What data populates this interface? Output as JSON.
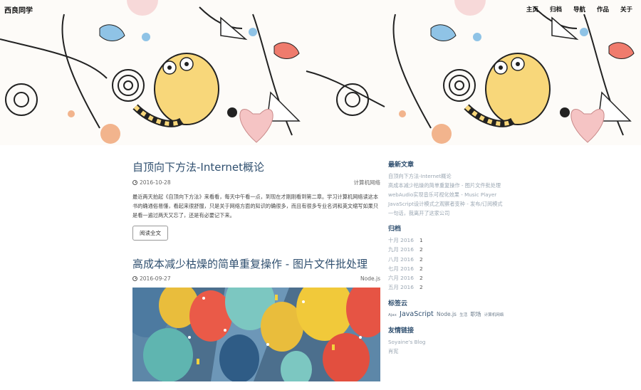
{
  "site": {
    "brand": "西良同学",
    "nav": [
      "主页",
      "归档",
      "导航",
      "作品",
      "关于"
    ]
  },
  "posts": [
    {
      "title": "自顶向下方法-Internet概论",
      "date": "2016-10-28",
      "category": "计算机网络",
      "excerpt": "最近两天拍起《自顶向下方法》来看看，每天中午看一点，到现在才刚刚看到第二章。学习计算机网络读这本书的确通俗易懂，看起来很舒服，只是关于网络方面的知识的确很多，而且有很多专业名词和英文缩写如果只是看一遍过两天又忘了，还是有必要记下来。",
      "button": "阅读全文"
    },
    {
      "title": "高成本减少枯燥的简单重复操作 - 图片文件批处理",
      "date": "2016-09-27",
      "category": "Node.js"
    }
  ],
  "sidebar": {
    "recent_title": "最新文章",
    "recent": [
      "自顶向下方法-Internet概论",
      "高成本减少枯燥的简单重复操作 - 图片文件批处理",
      "webAudio实现音乐可视化效果 - Music Player",
      "JavaScript设计模式之观察者变种 - 发布/订阅模式",
      "一句话，我离开了这家公司"
    ],
    "archive_title": "归档",
    "archive": [
      {
        "month": "十月 2016",
        "count": "1"
      },
      {
        "month": "九月 2016",
        "count": "2"
      },
      {
        "month": "八月 2016",
        "count": "2"
      },
      {
        "month": "七月 2016",
        "count": "2"
      },
      {
        "month": "六月 2016",
        "count": "2"
      },
      {
        "month": "五月 2016",
        "count": "2"
      }
    ],
    "tags_title": "标签云",
    "tags": [
      "Ajax",
      "JavaScript",
      "Node.js",
      "生活",
      "职场",
      "计算机网络"
    ],
    "links_title": "友情链接",
    "links": [
      "Soyaine's Blog",
      "肖宪"
    ]
  }
}
